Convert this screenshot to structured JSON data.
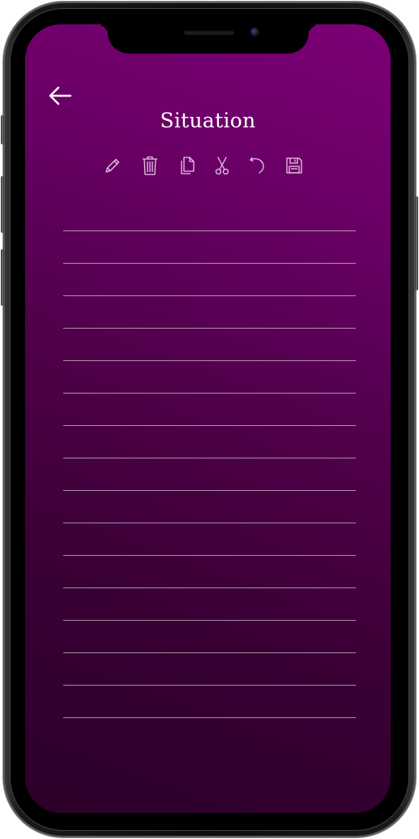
{
  "screen": {
    "title": "Situation",
    "background_top": "#7b0076",
    "background_bottom": "#2c0029"
  },
  "header": {
    "back_icon": "arrow-left-icon"
  },
  "toolbar": {
    "items": [
      {
        "icon": "pencil-icon"
      },
      {
        "icon": "trash-icon"
      },
      {
        "icon": "copy-icon"
      },
      {
        "icon": "scissors-icon"
      },
      {
        "icon": "undo-icon"
      },
      {
        "icon": "save-icon"
      }
    ]
  },
  "note": {
    "line_count": 16,
    "lines": [
      "",
      "",
      "",
      "",
      "",
      "",
      "",
      "",
      "",
      "",
      "",
      "",
      "",
      "",
      "",
      ""
    ]
  }
}
